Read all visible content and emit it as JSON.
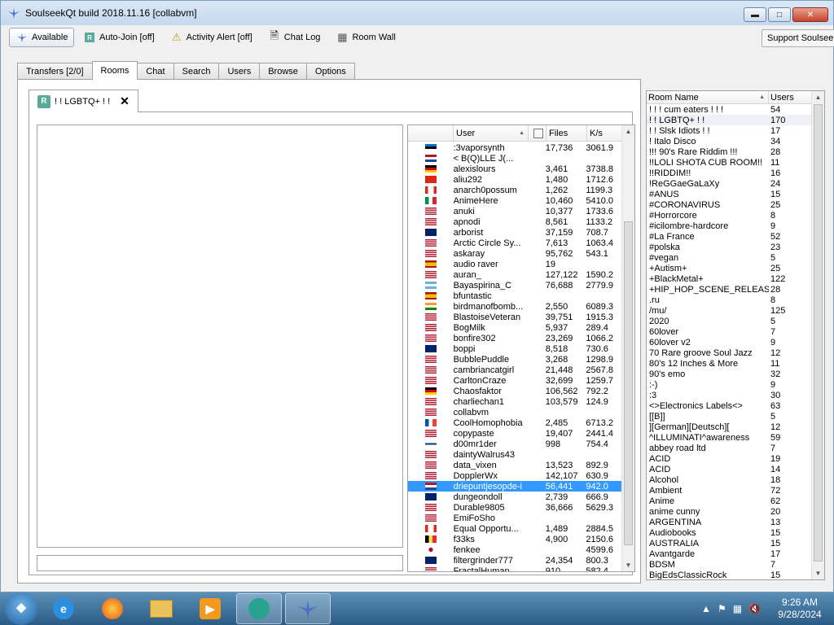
{
  "window": {
    "title": "SoulseekQt build 2018.11.16 [collabvm]"
  },
  "toolbar": {
    "available": "Available",
    "auto_join": "Auto-Join [off]",
    "activity_alert": "Activity Alert [off]",
    "chat_log": "Chat Log",
    "room_wall": "Room Wall",
    "support": "Support Soulseek"
  },
  "tabs": [
    "Transfers [2/0]",
    "Rooms",
    "Chat",
    "Search",
    "Users",
    "Browse",
    "Options"
  ],
  "room_tab": {
    "icon_letter": "R",
    "label": "! ! LGBTQ+ ! !",
    "close": "✕"
  },
  "userlist": {
    "headers": {
      "user": "User",
      "files": "Files",
      "ks": "K/s"
    },
    "rows": [
      {
        "name": ":3vaporsynth",
        "files": "17,736",
        "ks": "3061.9",
        "flag": "ee"
      },
      {
        "name": "< B(Q)LLE J(...",
        "files": "",
        "ks": "",
        "flag": "nl"
      },
      {
        "name": "alexislours",
        "files": "3,461",
        "ks": "3738.8",
        "flag": "de"
      },
      {
        "name": "aliu292",
        "files": "1,480",
        "ks": "1712.6",
        "flag": "cn"
      },
      {
        "name": "anarch0possum",
        "files": "1,262",
        "ks": "1199.3",
        "flag": "ca"
      },
      {
        "name": "AnimeHere",
        "files": "10,460",
        "ks": "5410.0",
        "flag": "it"
      },
      {
        "name": "anuki",
        "files": "10,377",
        "ks": "1733.6",
        "flag": "us"
      },
      {
        "name": "apnodi",
        "files": "8,561",
        "ks": "1133.2",
        "flag": "us"
      },
      {
        "name": "arborist",
        "files": "37,159",
        "ks": "708.7",
        "flag": "au"
      },
      {
        "name": "Arctic Circle Sy...",
        "files": "7,613",
        "ks": "1063.4",
        "flag": "us"
      },
      {
        "name": "askaray",
        "files": "95,762",
        "ks": "543.1",
        "flag": "us"
      },
      {
        "name": "audio raver",
        "files": "19",
        "ks": "",
        "flag": "es"
      },
      {
        "name": "auran_",
        "files": "127,122",
        "ks": "1590.2",
        "flag": "us"
      },
      {
        "name": "Bayaspirina_C",
        "files": "76,688",
        "ks": "2779.9",
        "flag": "ar"
      },
      {
        "name": "bfuntastic",
        "files": "",
        "ks": "",
        "flag": "es"
      },
      {
        "name": "birdmanofbomb...",
        "files": "2,550",
        "ks": "6089.3",
        "flag": "in"
      },
      {
        "name": "BlastoiseVeteran",
        "files": "39,751",
        "ks": "1915.3",
        "flag": "us"
      },
      {
        "name": "BogMilk",
        "files": "5,937",
        "ks": "289.4",
        "flag": "us"
      },
      {
        "name": "bonfire302",
        "files": "23,269",
        "ks": "1066.2",
        "flag": "us"
      },
      {
        "name": "boppi",
        "files": "8,518",
        "ks": "730.6",
        "flag": "au"
      },
      {
        "name": "BubblePuddle",
        "files": "3,268",
        "ks": "1298.9",
        "flag": "us"
      },
      {
        "name": "cambriancatgirl",
        "files": "21,448",
        "ks": "2567.8",
        "flag": "us"
      },
      {
        "name": "CarltonCraze",
        "files": "32,699",
        "ks": "1259.7",
        "flag": "us"
      },
      {
        "name": "Chaosfaktor",
        "files": "106,562",
        "ks": "792.2",
        "flag": "de"
      },
      {
        "name": "charliechan1",
        "files": "103,579",
        "ks": "124.9",
        "flag": "us"
      },
      {
        "name": "collabvm",
        "files": "",
        "ks": "",
        "flag": "us"
      },
      {
        "name": "CoolHomophobia",
        "files": "2,485",
        "ks": "6713.2",
        "flag": "fr"
      },
      {
        "name": "copypaste",
        "files": "19,407",
        "ks": "2441.4",
        "flag": "us"
      },
      {
        "name": "d00mr1der",
        "files": "998",
        "ks": "754.4",
        "flag": "fi"
      },
      {
        "name": "daintyWalrus43",
        "files": "",
        "ks": "",
        "flag": "us"
      },
      {
        "name": "data_vixen",
        "files": "13,523",
        "ks": "892.9",
        "flag": "us"
      },
      {
        "name": "DopplerWx",
        "files": "142,107",
        "ks": "630.9",
        "flag": "us"
      },
      {
        "name": "driepuntjesopde-i",
        "files": "56,441",
        "ks": "942.0",
        "flag": "nl",
        "selected": true
      },
      {
        "name": "dungeondoll",
        "files": "2,739",
        "ks": "666.9",
        "flag": "gb"
      },
      {
        "name": "Durable9805",
        "files": "36,666",
        "ks": "5629.3",
        "flag": "us"
      },
      {
        "name": "EmiFoSho",
        "files": "",
        "ks": "",
        "flag": "us"
      },
      {
        "name": "Equal Opportu...",
        "files": "1,489",
        "ks": "2884.5",
        "flag": "ca"
      },
      {
        "name": "f33ks",
        "files": "4,900",
        "ks": "2150.6",
        "flag": "be"
      },
      {
        "name": "fenkee",
        "files": "",
        "ks": "4599.6",
        "flag": "jp"
      },
      {
        "name": "filtergrinder777",
        "files": "24,354",
        "ks": "800.3",
        "flag": "au"
      },
      {
        "name": "FractalHuman",
        "files": "910",
        "ks": "582.4",
        "flag": "us"
      }
    ]
  },
  "roomlist": {
    "headers": {
      "name": "Room Name",
      "users": "Users"
    },
    "rows": [
      {
        "name": "! ! ! cum eaters ! ! !",
        "users": "54"
      },
      {
        "name": "! ! LGBTQ+ ! !",
        "users": "170",
        "highlight": true
      },
      {
        "name": "! ! Slsk Idiots ! !",
        "users": "17"
      },
      {
        "name": "! Italo Disco",
        "users": "34"
      },
      {
        "name": "!!! 90's Rare Riddim !!!",
        "users": "28"
      },
      {
        "name": "!!LOLI SHOTA CUB ROOM!!",
        "users": "11"
      },
      {
        "name": "!!RIDDIM!!",
        "users": "16"
      },
      {
        "name": "!ReGGaeGaLaXy",
        "users": "24"
      },
      {
        "name": "#ANUS",
        "users": "15"
      },
      {
        "name": "#CORONAVIRUS",
        "users": "25"
      },
      {
        "name": "#Horrorcore",
        "users": "8"
      },
      {
        "name": "#icilombre-hardcore",
        "users": "9"
      },
      {
        "name": "#La France",
        "users": "52"
      },
      {
        "name": "#polska",
        "users": "23"
      },
      {
        "name": "#vegan",
        "users": "5"
      },
      {
        "name": "+Autism+",
        "users": "25"
      },
      {
        "name": "+BlackMetal+",
        "users": "122"
      },
      {
        "name": "+HIP_HOP_SCENE_RELEAS...",
        "users": "28"
      },
      {
        "name": ".ru",
        "users": "8"
      },
      {
        "name": "/mu/",
        "users": "125"
      },
      {
        "name": "2020",
        "users": "5"
      },
      {
        "name": "60lover",
        "users": "7"
      },
      {
        "name": "60lover v2",
        "users": "9"
      },
      {
        "name": "70 Rare groove Soul Jazz",
        "users": "12"
      },
      {
        "name": "80's 12 Inches & More",
        "users": "11"
      },
      {
        "name": "90's emo",
        "users": "32"
      },
      {
        "name": ":-)",
        "users": "9"
      },
      {
        "name": ":3",
        "users": "30"
      },
      {
        "name": "<>Electronics Labels<>",
        "users": "63"
      },
      {
        "name": "[[B]]",
        "users": "5"
      },
      {
        "name": "][German][Deutsch][",
        "users": "12"
      },
      {
        "name": "^ILLUMINATI^awareness",
        "users": "59"
      },
      {
        "name": "abbey road ltd",
        "users": "7"
      },
      {
        "name": "ACID",
        "users": "19"
      },
      {
        "name": "ACID",
        "users": "14"
      },
      {
        "name": "Alcohol",
        "users": "18"
      },
      {
        "name": "Ambient",
        "users": "72"
      },
      {
        "name": "Anime",
        "users": "62"
      },
      {
        "name": "anime cunny",
        "users": "20"
      },
      {
        "name": "ARGENTINA",
        "users": "13"
      },
      {
        "name": "Audiobooks",
        "users": "15"
      },
      {
        "name": "AUSTRALIA",
        "users": "15"
      },
      {
        "name": "Avantgarde",
        "users": "17"
      },
      {
        "name": "BDSM",
        "users": "7"
      },
      {
        "name": "BigEdsClassicRock",
        "users": "15"
      }
    ]
  },
  "taskbar": {
    "time": "9:26 AM",
    "date": "9/28/2024"
  },
  "colors": {
    "selection": "#3399ff",
    "title_bg": "#dbe8f5"
  }
}
